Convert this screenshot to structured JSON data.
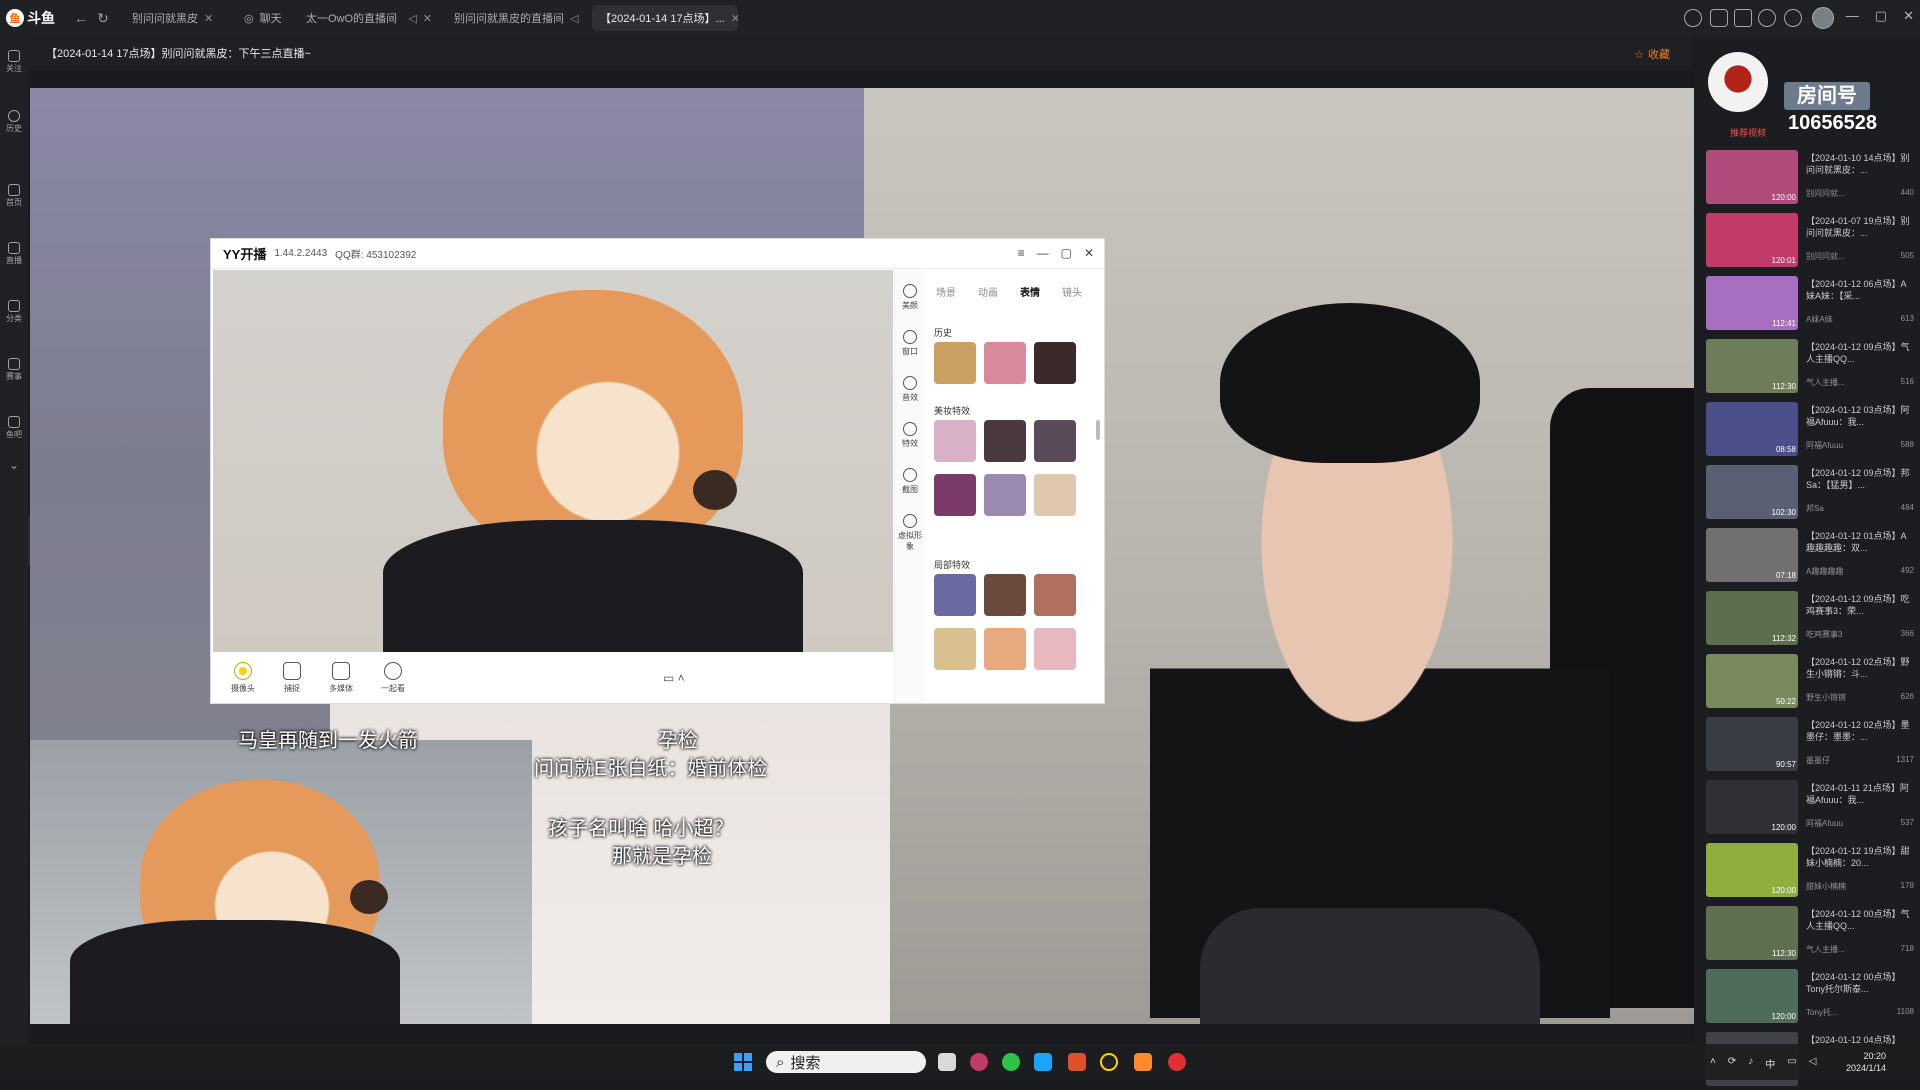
{
  "topbar": {
    "logo": "斗鱼",
    "tabs": [
      {
        "label": "别问问就黑皮",
        "active": false
      },
      {
        "label": "聊天",
        "active": false
      },
      {
        "label": "太一OwO的直播间",
        "active": false
      },
      {
        "label": "别问问就黑皮的直播间",
        "active": false
      },
      {
        "label": "【2024-01-14 17点场】...",
        "active": true
      }
    ]
  },
  "sidebar": [
    "关注",
    "历史",
    "首页",
    "直播",
    "分类",
    "赛事",
    "鱼吧"
  ],
  "title_strip": {
    "text": "【2024-01-14 17点场】别问问就黑皮：下午三点直播~",
    "favorite": "收藏"
  },
  "yy": {
    "brand": "YY开播",
    "version": "1.44.2.2443",
    "qq": "QQ群: 453102392",
    "side_items": [
      "美颜",
      "窗口",
      "音效",
      "特效",
      "截图",
      "虚拟形象"
    ],
    "tabs": [
      "场景",
      "动画",
      "表情",
      "镜头"
    ],
    "active_tab": "表情",
    "sections": [
      "历史",
      "美妆特效",
      "局部特效"
    ],
    "bottom_tools": [
      "摄像头",
      "捕捉",
      "多媒体",
      "一起看"
    ]
  },
  "subtitles": [
    "马皇再随到一发火箭",
    "孕检",
    "问问就E张白纸：婚前体检",
    "孩子名叫啥 哈小超？",
    "那就是孕检"
  ],
  "right_panel": {
    "room_label": "房间号",
    "room_number": "10656528",
    "recommend": "推荐视频",
    "videos": [
      {
        "title": "【2024-01-10 14点场】别问问就黑皮：...",
        "author": "别问问就...",
        "views": "440",
        "duration": "120:00",
        "color": "#b04a7a"
      },
      {
        "title": "【2024-01-07 19点场】别问问就黑皮：...",
        "author": "别问问就...",
        "views": "505",
        "duration": "120:01",
        "color": "#c23a6a"
      },
      {
        "title": "【2024-01-12 06点场】A妹A妹：【采...",
        "author": "A妹A妹",
        "views": "613",
        "duration": "112:41",
        "color": "#a86ec0"
      },
      {
        "title": "【2024-01-12 09点场】气人主播QQ...",
        "author": "气人主播...",
        "views": "516",
        "duration": "112:30",
        "color": "#6d7d5a"
      },
      {
        "title": "【2024-01-12 03点场】阿福Afuuu：我...",
        "author": "阿福Afuuu",
        "views": "588",
        "duration": "08:58",
        "color": "#4a4f8a"
      },
      {
        "title": "【2024-01-12 09点场】邦Sa：【猛男】...",
        "author": "邦Sa",
        "views": "484",
        "duration": "102:30",
        "color": "#5a5f74"
      },
      {
        "title": "【2024-01-12 01点场】A趣趣趣趣：双...",
        "author": "A趣趣趣趣",
        "views": "492",
        "duration": "07:18",
        "color": "#707070"
      },
      {
        "title": "【2024-01-12 09点场】吃鸡赛事3：荣...",
        "author": "吃鸡赛事3",
        "views": "366",
        "duration": "112:32",
        "color": "#5d6e4e"
      },
      {
        "title": "【2024-01-12 02点场】野生小锵锵：斗...",
        "author": "野生小锵锵",
        "views": "626",
        "duration": "50:22",
        "color": "#7a8a5e"
      },
      {
        "title": "【2024-01-12 02点场】墨墨仔：墨墨：...",
        "author": "墨墨仔",
        "views": "1317",
        "duration": "90:57",
        "color": "#3a3c44"
      },
      {
        "title": "【2024-01-11 21点场】阿福Afuuu：我...",
        "author": "阿福Afuuu",
        "views": "537",
        "duration": "120:00",
        "color": "#2f3036"
      },
      {
        "title": "【2024-01-12 19点场】甜妹小楠楠：20...",
        "author": "甜妹小楠楠",
        "views": "178",
        "duration": "120:00",
        "color": "#8fae3c"
      },
      {
        "title": "【2024-01-12 00点场】气人主播QQ...",
        "author": "气人主播...",
        "views": "718",
        "duration": "112:30",
        "color": "#5f7050"
      },
      {
        "title": "【2024-01-12 00点场】Tony托尔斯泰...",
        "author": "Tony托...",
        "views": "1108",
        "duration": "120:00",
        "color": "#4f6b5a"
      },
      {
        "title": "【2024-01-12 04点场】",
        "author": "",
        "views": "",
        "duration": "",
        "color": "#404248"
      }
    ]
  },
  "taskbar": {
    "search": "搜索",
    "time": "20:20",
    "date": "2024/1/14"
  }
}
